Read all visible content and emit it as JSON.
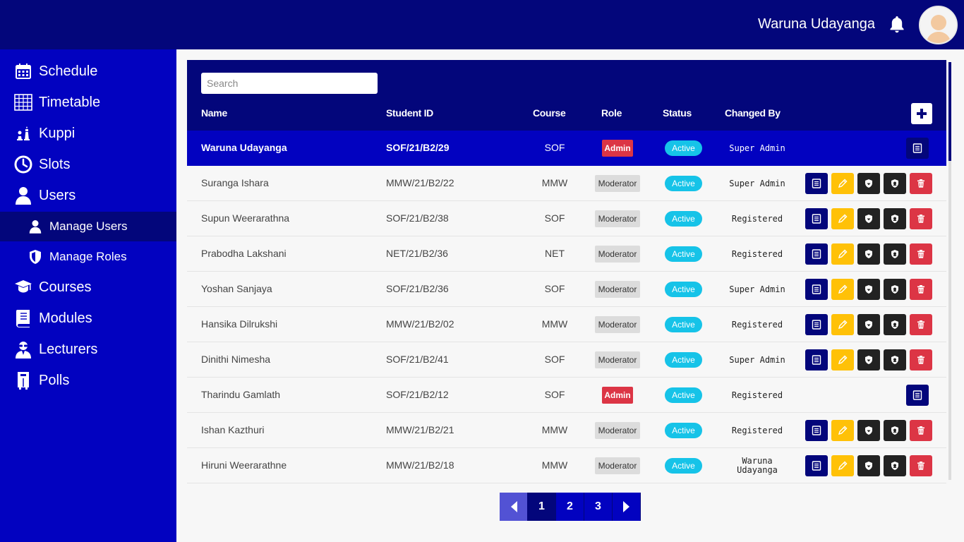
{
  "header": {
    "user_name": "Waruna Udayanga"
  },
  "sidebar": {
    "items": [
      {
        "label": "Schedule",
        "icon": "calendar-icon"
      },
      {
        "label": "Timetable",
        "icon": "grid-icon"
      },
      {
        "label": "Kuppi",
        "icon": "chess-icon"
      },
      {
        "label": "Slots",
        "icon": "clock-icon"
      },
      {
        "label": "Users",
        "icon": "user-icon"
      },
      {
        "label": "Courses",
        "icon": "graduation-cap-icon"
      },
      {
        "label": "Modules",
        "icon": "book-icon"
      },
      {
        "label": "Lecturers",
        "icon": "lecturer-icon"
      },
      {
        "label": "Polls",
        "icon": "ballot-box-icon"
      }
    ],
    "sub_items": [
      {
        "label": "Manage Users",
        "icon": "user-icon",
        "active": true
      },
      {
        "label": "Manage Roles",
        "icon": "shield-icon",
        "active": false
      }
    ]
  },
  "table": {
    "search_placeholder": "Search",
    "columns": [
      "Name",
      "Student ID",
      "Course",
      "Role",
      "Status",
      "Changed By"
    ],
    "rows": [
      {
        "name": "Waruna Udayanga",
        "id": "SOF/21/B2/29",
        "course": "SOF",
        "role": "Admin",
        "status": "Active",
        "changed_by": "Super Admin"
      },
      {
        "name": "Suranga Ishara",
        "id": "MMW/21/B2/22",
        "course": "MMW",
        "role": "Moderator",
        "status": "Active",
        "changed_by": "Super Admin"
      },
      {
        "name": "Supun Weerarathna",
        "id": "SOF/21/B2/38",
        "course": "SOF",
        "role": "Moderator",
        "status": "Active",
        "changed_by": "Registered"
      },
      {
        "name": "Prabodha Lakshani",
        "id": "NET/21/B2/36",
        "course": "NET",
        "role": "Moderator",
        "status": "Active",
        "changed_by": "Registered"
      },
      {
        "name": "Yoshan Sanjaya",
        "id": "SOF/21/B2/36",
        "course": "SOF",
        "role": "Moderator",
        "status": "Active",
        "changed_by": "Super Admin"
      },
      {
        "name": "Hansika Dilrukshi",
        "id": "MMW/21/B2/02",
        "course": "MMW",
        "role": "Moderator",
        "status": "Active",
        "changed_by": "Registered"
      },
      {
        "name": "Dinithi Nimesha",
        "id": "SOF/21/B2/41",
        "course": "SOF",
        "role": "Moderator",
        "status": "Active",
        "changed_by": "Super Admin"
      },
      {
        "name": "Tharindu Gamlath",
        "id": "SOF/21/B2/12",
        "course": "SOF",
        "role": "Admin",
        "status": "Active",
        "changed_by": "Registered"
      },
      {
        "name": "Ishan Kazthuri",
        "id": "MMW/21/B2/21",
        "course": "MMW",
        "role": "Moderator",
        "status": "Active",
        "changed_by": "Registered"
      },
      {
        "name": "Hiruni Weerarathne",
        "id": "MMW/21/B2/18",
        "course": "MMW",
        "role": "Moderator",
        "status": "Active",
        "changed_by": "Waruna Udayanga"
      }
    ]
  },
  "pagination": {
    "pages": [
      "1",
      "2",
      "3"
    ],
    "current": "1"
  },
  "colors": {
    "header_bg": "#03067b",
    "sidebar_bg": "#0202c0",
    "status_active": "#16c3e8",
    "admin_badge": "#dc3545",
    "edit_button": "#ffc107"
  }
}
